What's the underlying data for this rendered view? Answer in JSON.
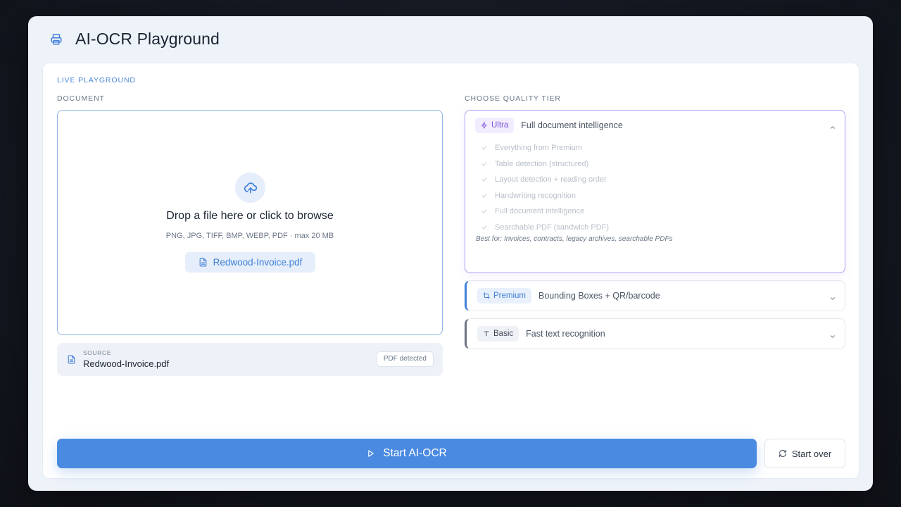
{
  "header": {
    "title": "AI-OCR Playground",
    "icon": "printer-icon"
  },
  "panel": {
    "live_label": "LIVE PLAYGROUND",
    "document_label": "DOCUMENT",
    "tier_label": "CHOOSE QUALITY TIER"
  },
  "dropzone": {
    "title": "Drop a file here or click to browse",
    "subtitle": "PNG, JPG, TIFF, BMP, WEBP, PDF · max 20 MB",
    "file_name": "Redwood-Invoice.pdf"
  },
  "source": {
    "tag": "SOURCE",
    "name": "Redwood-Invoice.pdf",
    "badge": "PDF detected"
  },
  "tiers": {
    "ultra": {
      "badge": "Ultra",
      "desc": "Full document intelligence",
      "expanded": true,
      "features": [
        "Everything from Premium",
        "Table detection (structured)",
        "Layout detection + reading order",
        "Handwriting recognition",
        "Full document intelligence",
        "Searchable PDF (sandwich PDF)"
      ],
      "best_for": "Best for: Invoices, contracts, legacy archives, searchable PDFs",
      "accent": "#b59cf0"
    },
    "premium": {
      "badge": "Premium",
      "desc": "Bounding Boxes + QR/barcode",
      "accent": "#3f7fd8"
    },
    "basic": {
      "badge": "Basic",
      "desc": "Fast text recognition",
      "accent": "#6b7585"
    }
  },
  "actions": {
    "start": "Start AI-OCR",
    "start_over": "Start over"
  },
  "colors": {
    "primary": "#4a8ae0",
    "ultra_accent": "#7a55d4"
  }
}
